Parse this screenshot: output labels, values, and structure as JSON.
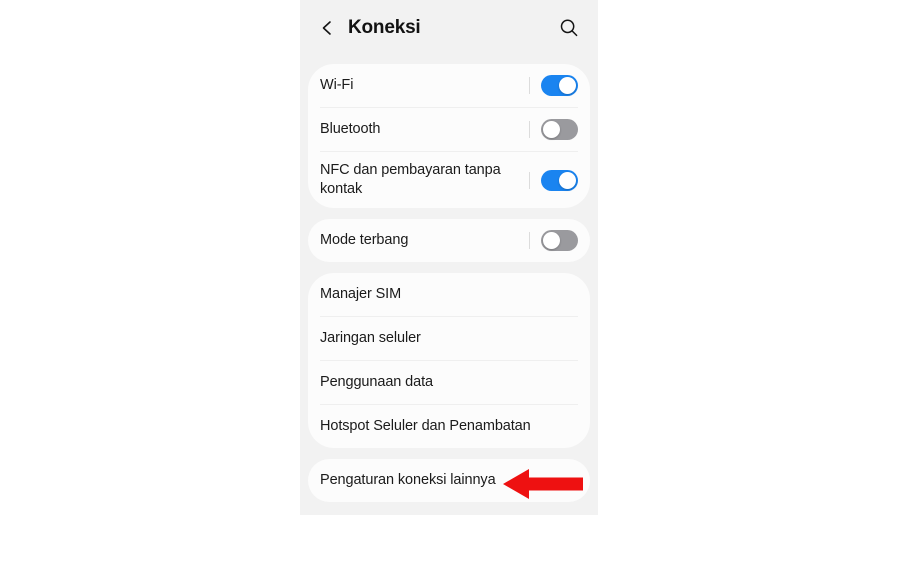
{
  "app_bar": {
    "back_icon": "chevron-left-icon",
    "title": "Koneksi",
    "search_icon": "search-icon"
  },
  "colors": {
    "page_background": "#ffffff",
    "screen_background": "#f2f2f2",
    "card_background": "#fcfcfc",
    "toggle_on": "#1a84f0",
    "toggle_off": "#9a9a9e",
    "text_primary": "#1b1b1b",
    "annotation_arrow": "#ee1111"
  },
  "groups": [
    {
      "name": "wireless-group",
      "rows": [
        {
          "label": "Wi-Fi",
          "type": "toggle",
          "state": "on"
        },
        {
          "label": "Bluetooth",
          "type": "toggle",
          "state": "off"
        },
        {
          "label": "NFC dan pembayaran tanpa kontak",
          "type": "toggle",
          "state": "on"
        }
      ]
    },
    {
      "name": "airplane-group",
      "rows": [
        {
          "label": "Mode terbang",
          "type": "toggle",
          "state": "off"
        }
      ]
    },
    {
      "name": "network-group",
      "rows": [
        {
          "label": "Manajer SIM",
          "type": "link"
        },
        {
          "label": "Jaringan seluler",
          "type": "link"
        },
        {
          "label": "Penggunaan data",
          "type": "link"
        },
        {
          "label": "Hotspot Seluler dan Penambatan",
          "type": "link"
        }
      ]
    },
    {
      "name": "more-settings-group",
      "rows": [
        {
          "label": "Pengaturan koneksi lainnya",
          "type": "link"
        }
      ]
    }
  ],
  "annotation": {
    "name": "red-arrow-pointing-left",
    "points_to": "Pengaturan koneksi lainnya",
    "direction": "left"
  }
}
